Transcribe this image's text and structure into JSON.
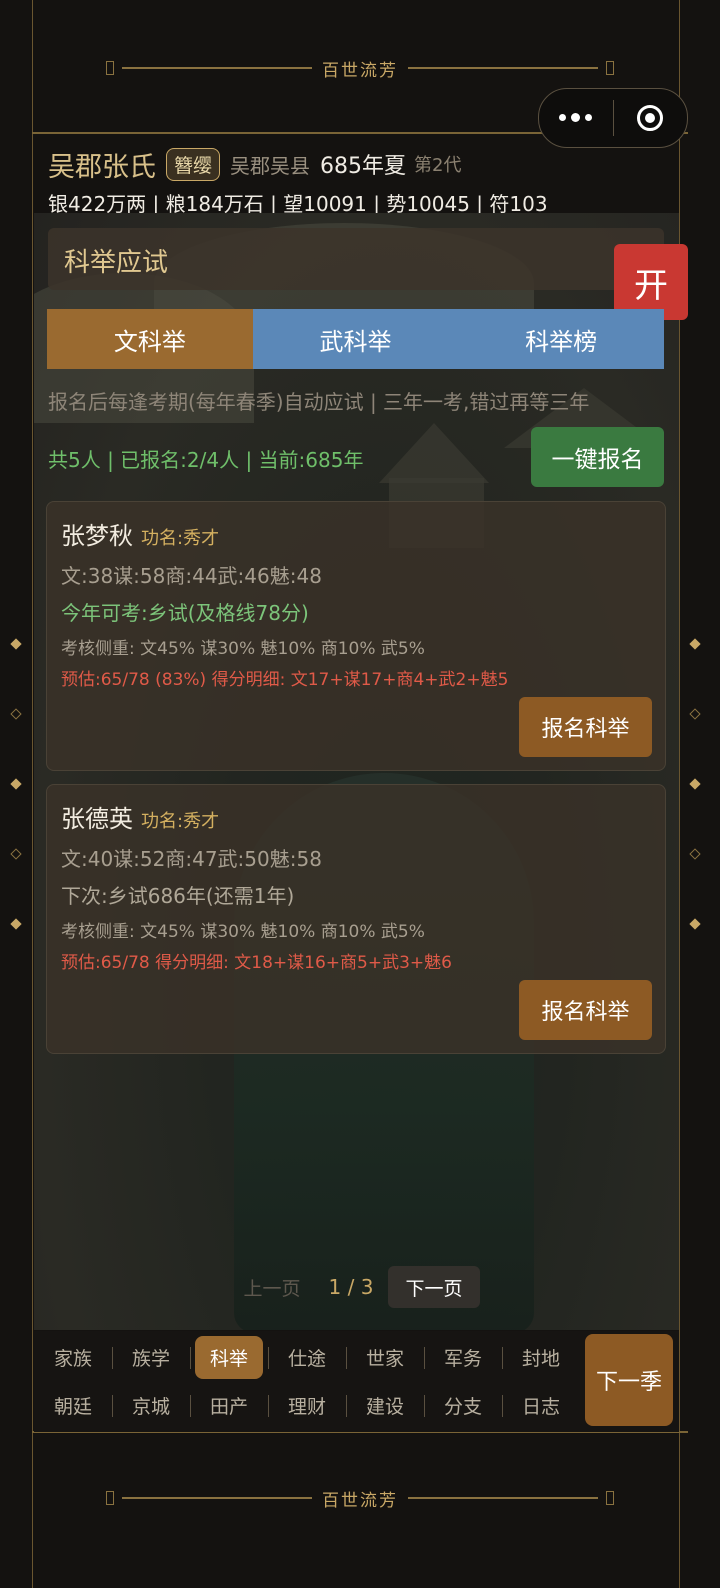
{
  "banner": {
    "top_text": "百世流芳",
    "bottom_text": "百世流芳"
  },
  "header": {
    "clan": "吴郡张氏",
    "tag": "簪缨",
    "region": "吴郡吴县",
    "year": "685年夏",
    "generation": "第2代",
    "resources": "银422万两 | 粮184万石 | 望10091 | 势10045 | 符103"
  },
  "panel": {
    "title": "科举应试",
    "open_label": "开"
  },
  "tabs": [
    "文科举",
    "武科举",
    "科举榜"
  ],
  "notice": "报名后每逢考期(每年春季)自动应试 | 三年一考,错过再等三年",
  "counts": "共5人 | 已报名:2/4人 | 当前:685年",
  "one_key_label": "一键报名",
  "candidates": [
    {
      "name": "张梦秋",
      "rank": "功名:秀才",
      "stats": "文:38谋:58商:44武:46魅:48",
      "exam": "今年可考:乡试(及格线78分)",
      "focus": "考核侧重: 文45% 谋30% 魅10% 商10% 武5%",
      "estimate": "预估:65/78 (83%)  得分明细: 文17+谋17+商4+武2+魅5",
      "register_label": "报名科举"
    },
    {
      "name": "张德英",
      "rank": "功名:秀才",
      "stats": "文:40谋:52商:47武:50魅:58",
      "exam": "下次:乡试686年(还需1年)",
      "focus": "考核侧重: 文45% 谋30% 魅10% 商10% 武5%",
      "estimate": "预估:65/78  得分明细: 文18+谋16+商5+武3+魅6",
      "register_label": "报名科举"
    }
  ],
  "pager": {
    "prev": "上一页",
    "page": "1 / 3",
    "next": "下一页"
  },
  "nav": {
    "row1": [
      "家族",
      "族学",
      "科举",
      "仕途",
      "世家",
      "军务",
      "封地"
    ],
    "row2": [
      "朝廷",
      "京城",
      "田产",
      "理财",
      "建设",
      "分支",
      "日志"
    ],
    "next_season": "下一季"
  },
  "colors": {
    "accent_gold": "#c9a866",
    "tab_active": "#9a6a30",
    "tab_inactive": "#5b88b8",
    "open_red": "#c93832",
    "green": "#3a7a40"
  }
}
